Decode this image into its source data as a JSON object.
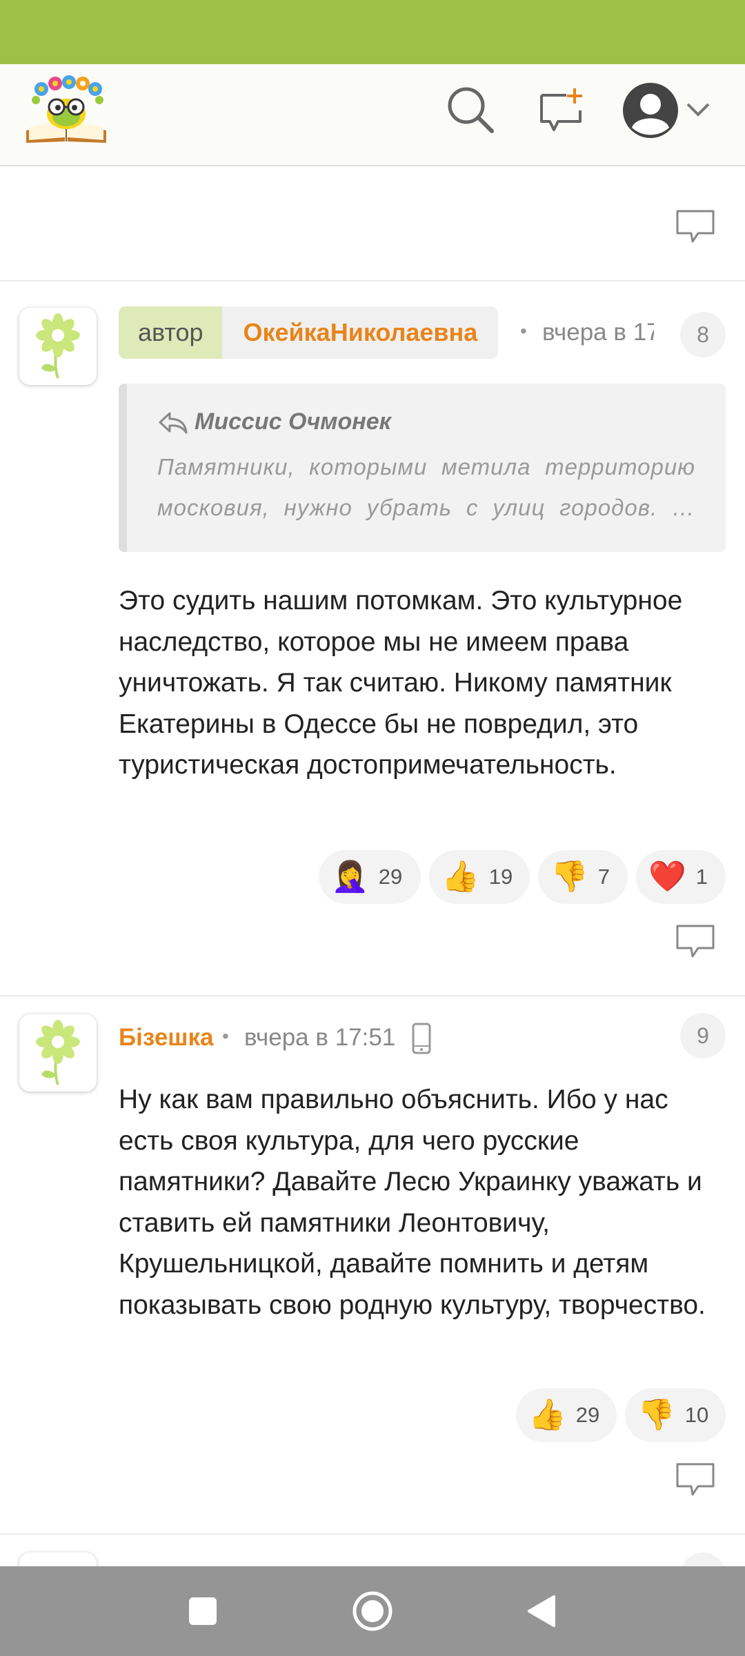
{
  "comments": [
    {
      "number": "8",
      "author_tag": "автор",
      "author": "ОкейкаНиколаевна",
      "dot": "•",
      "time": "вчера в 17:",
      "quote": {
        "author": "Миссис Очмонек",
        "text": "Памятники, которыми метила территорию московия, нужно убрать с улиц городов. …"
      },
      "text": "Это судить нашим потомкам. Это культурное наследство, которое мы не имеем права уничтожать. Я так считаю. Никому памятник Екатерины в Одессе бы не повредил, это туристическая достопримечательность.",
      "reactions": [
        {
          "emoji": "🤦‍♀️",
          "icon": "facepalm-icon",
          "count": "29"
        },
        {
          "emoji": "👍",
          "icon": "thumbs-up-icon",
          "count": "19"
        },
        {
          "emoji": "👎",
          "icon": "thumbs-down-icon",
          "count": "7"
        },
        {
          "emoji": "❤️",
          "icon": "heart-icon",
          "count": "1"
        }
      ]
    },
    {
      "number": "9",
      "author": "Бізешка",
      "dot": "•",
      "time": "вчера в 17:51",
      "device_icon": "mobile-phone-icon",
      "text": "Ну как вам правильно объяснить. Ибо у нас есть своя культура, для чего русские памятники? Давайте Лесю Украинку уважать и ставить ей памятники Леонтовичу, Крушельницкой, давайте помнить и детям показывать свою родную культуру, творчество.",
      "reactions": [
        {
          "emoji": "👍",
          "icon": "thumbs-up-icon",
          "count": "29"
        },
        {
          "emoji": "👎",
          "icon": "thumbs-down-icon",
          "count": "10"
        }
      ]
    }
  ],
  "colors": {
    "status_bar": "#9dc146",
    "accent_orange": "#e8841a",
    "header_bg": "#fbfbf7",
    "nav_bar": "#959595"
  },
  "icons": {
    "logo": "bookworm-logo",
    "search": "search-icon",
    "new_post": "new-post-icon",
    "profile": "user-avatar-icon",
    "menu": "chevron-down-icon",
    "reply": "reply-icon",
    "nav_recent": "square-icon",
    "nav_home": "circle-icon",
    "nav_back": "triangle-back-icon"
  }
}
